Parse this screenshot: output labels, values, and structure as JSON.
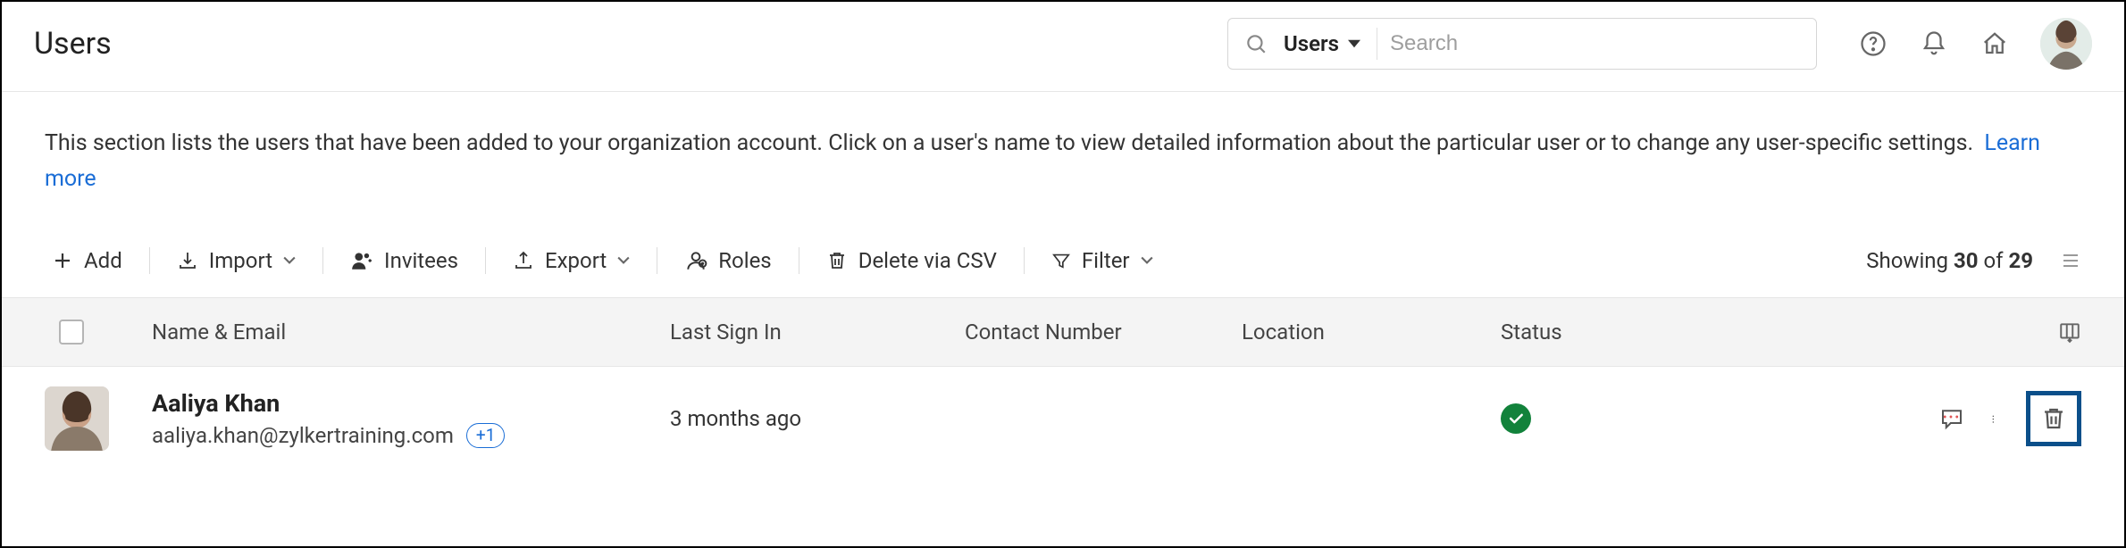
{
  "header": {
    "title": "Users",
    "search_scope_label": "Users",
    "search_placeholder": "Search"
  },
  "description": {
    "text": "This section lists the users that have been added to your organization account. Click on a user's name to view detailed information about the particular user or to change any user-specific settings.",
    "learn_more_label": "Learn more"
  },
  "toolbar": {
    "add_label": "Add",
    "import_label": "Import",
    "invitees_label": "Invitees",
    "export_label": "Export",
    "roles_label": "Roles",
    "delete_csv_label": "Delete via CSV",
    "filter_label": "Filter",
    "showing_prefix": "Showing ",
    "showing_count": "30",
    "showing_of": " of ",
    "showing_total": "29"
  },
  "columns": {
    "name_email": "Name & Email",
    "last_sign_in": "Last Sign In",
    "contact_number": "Contact Number",
    "location": "Location",
    "status": "Status"
  },
  "rows": [
    {
      "name": "Aaliya Khan",
      "email": "aaliya.khan@zylkertraining.com",
      "extra_emails_badge": "+1",
      "last_sign_in": "3 months ago",
      "contact_number": "",
      "location": "",
      "status_color": "#12823b"
    }
  ]
}
